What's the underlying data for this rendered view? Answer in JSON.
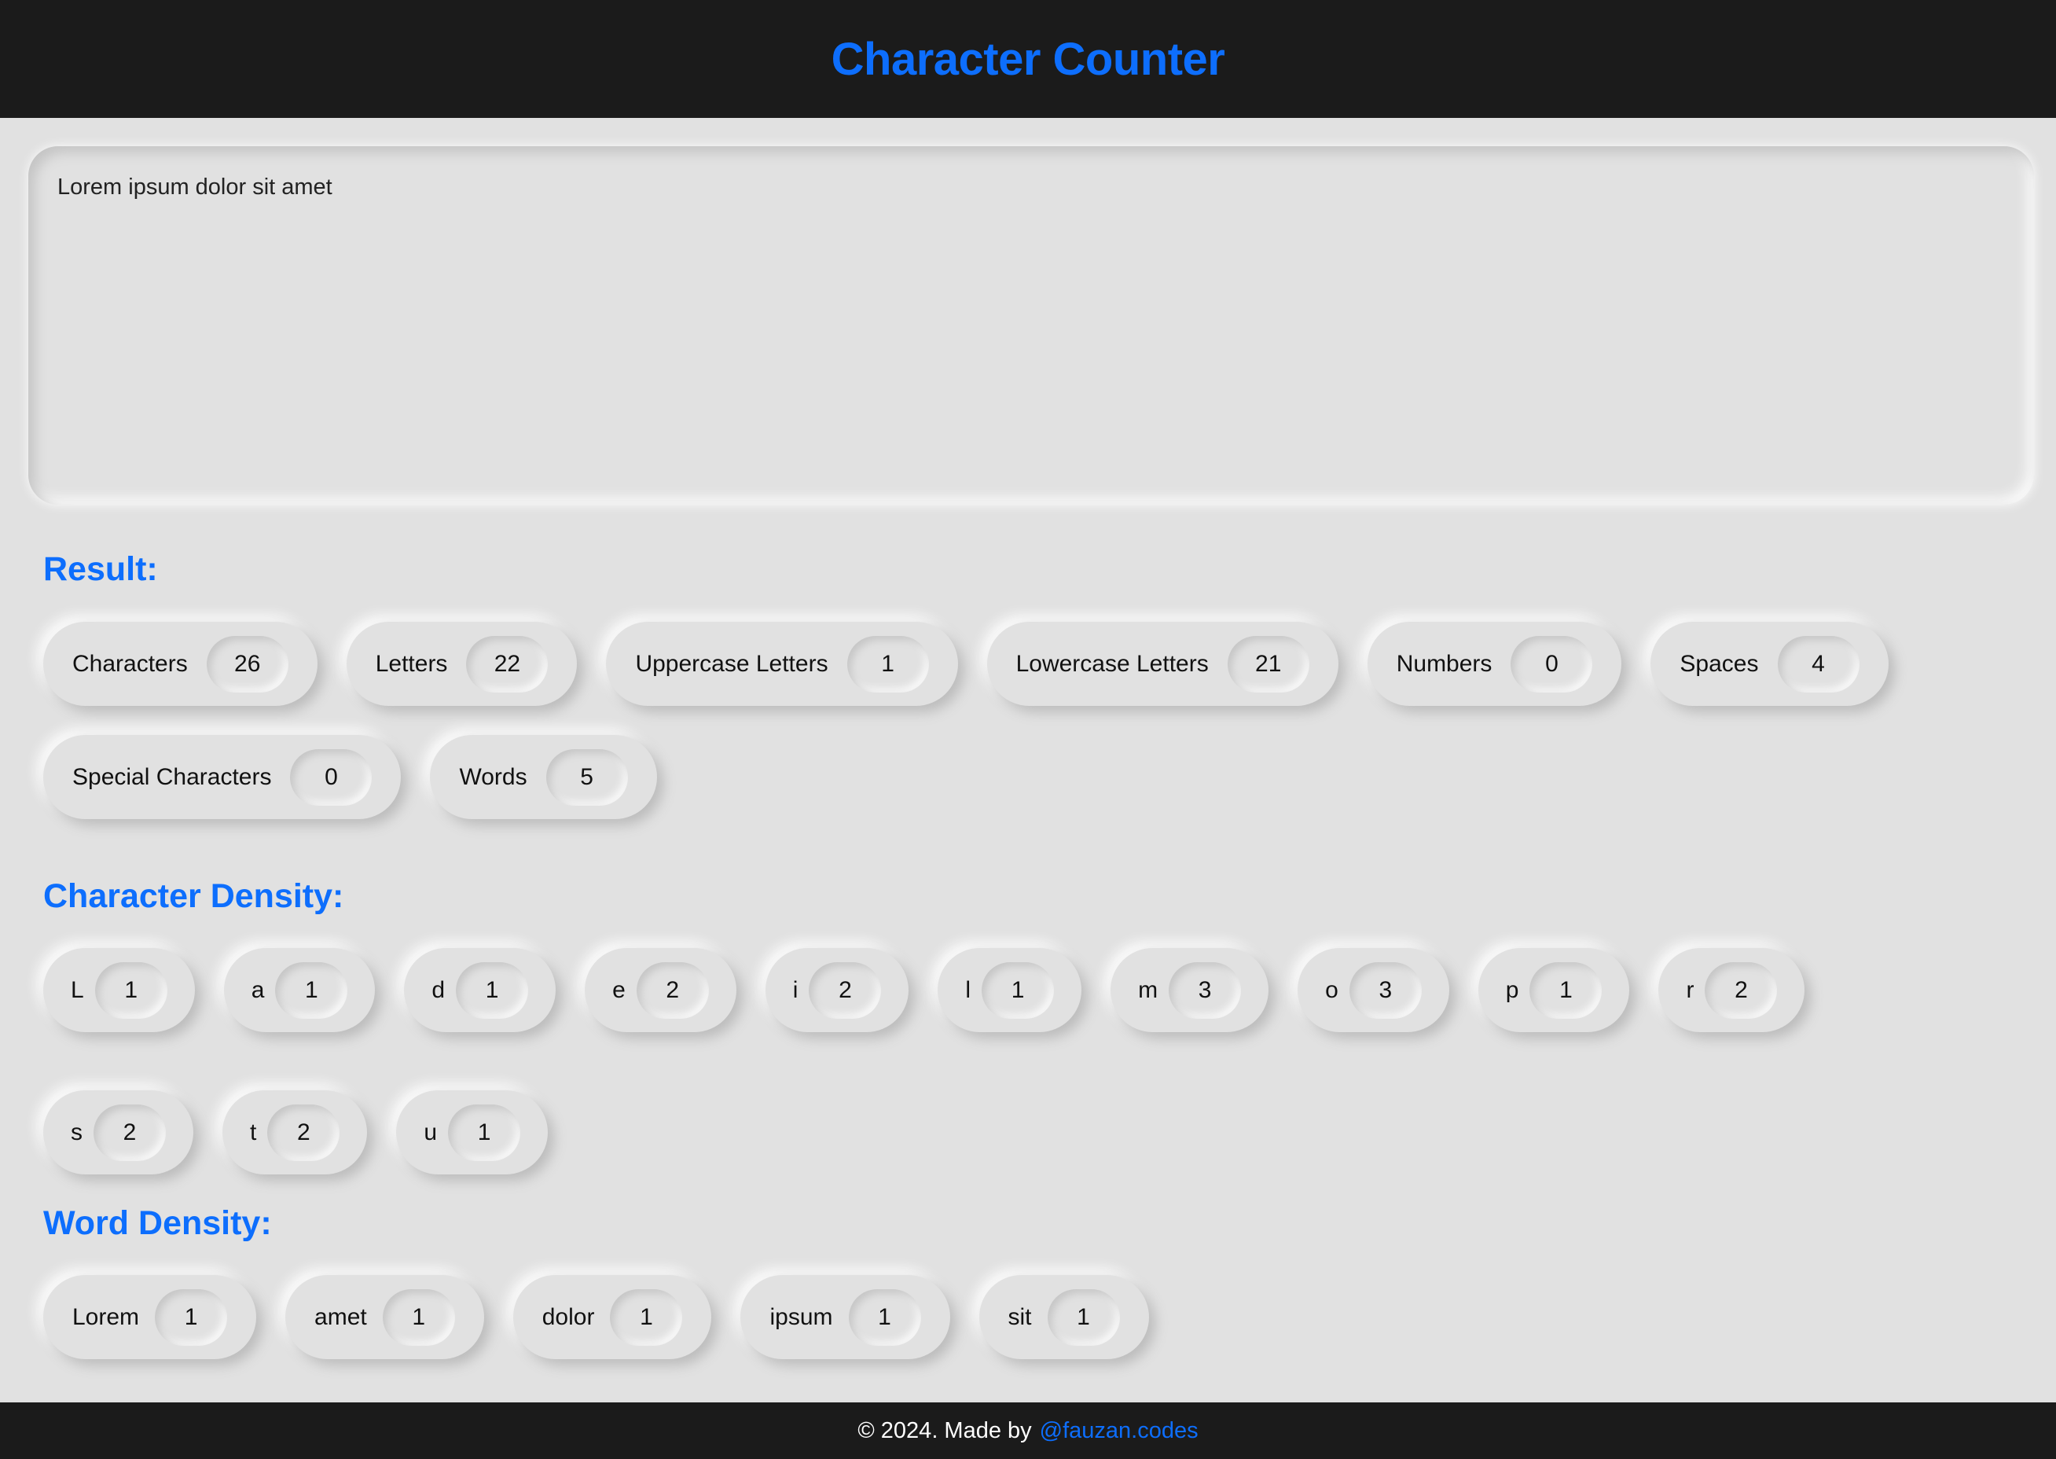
{
  "header": {
    "title": "Character Counter"
  },
  "input": {
    "value": "Lorem ipsum dolor sit amet"
  },
  "result": {
    "title": "Result:",
    "items": [
      {
        "label": "Characters",
        "count": "26"
      },
      {
        "label": "Letters",
        "count": "22"
      },
      {
        "label": "Uppercase Letters",
        "count": "1"
      },
      {
        "label": "Lowercase Letters",
        "count": "21"
      },
      {
        "label": "Numbers",
        "count": "0"
      },
      {
        "label": "Spaces",
        "count": "4"
      },
      {
        "label": "Special Characters",
        "count": "0"
      },
      {
        "label": "Words",
        "count": "5"
      }
    ]
  },
  "character_density": {
    "title": "Character Density:",
    "items": [
      {
        "label": "L",
        "count": "1"
      },
      {
        "label": "a",
        "count": "1"
      },
      {
        "label": "d",
        "count": "1"
      },
      {
        "label": "e",
        "count": "2"
      },
      {
        "label": "i",
        "count": "2"
      },
      {
        "label": "l",
        "count": "1"
      },
      {
        "label": "m",
        "count": "3"
      },
      {
        "label": "o",
        "count": "3"
      },
      {
        "label": "p",
        "count": "1"
      },
      {
        "label": "r",
        "count": "2"
      },
      {
        "label": "s",
        "count": "2"
      },
      {
        "label": "t",
        "count": "2"
      },
      {
        "label": "u",
        "count": "1"
      }
    ]
  },
  "word_density": {
    "title": "Word Density:",
    "items": [
      {
        "label": "Lorem",
        "count": "1"
      },
      {
        "label": "amet",
        "count": "1"
      },
      {
        "label": "dolor",
        "count": "1"
      },
      {
        "label": "ipsum",
        "count": "1"
      },
      {
        "label": "sit",
        "count": "1"
      }
    ]
  },
  "footer": {
    "text": "© 2024. Made by",
    "link": "@fauzan.codes"
  },
  "colors": {
    "accent": "#0d6efd",
    "background": "#e1e1e1",
    "bar": "#1b1b1b"
  }
}
